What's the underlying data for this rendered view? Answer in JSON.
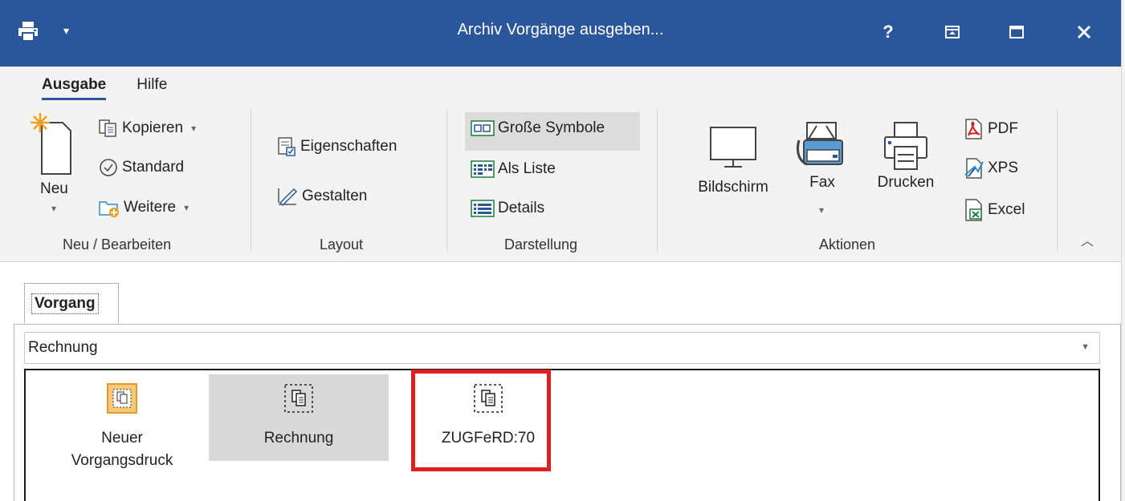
{
  "window": {
    "title": "Archiv Vorgänge ausgeben...",
    "help_label": "?",
    "qa_arrow": "▾"
  },
  "ribbon": {
    "tabs": [
      {
        "label": "Ausgabe",
        "active": true
      },
      {
        "label": "Hilfe",
        "active": false
      }
    ],
    "groups": {
      "neu": {
        "label": "Neu / Bearbeiten",
        "neu_button": "Neu",
        "kopieren": "Kopieren",
        "standard": "Standard",
        "weitere": "Weitere"
      },
      "layout": {
        "label": "Layout",
        "eigenschaften": "Eigenschaften",
        "gestalten": "Gestalten"
      },
      "darstellung": {
        "label": "Darstellung",
        "grosse_symbole": "Große Symbole",
        "als_liste": "Als Liste",
        "details": "Details"
      },
      "aktionen": {
        "label": "Aktionen",
        "bildschirm": "Bildschirm",
        "fax": "Fax",
        "drucken": "Drucken",
        "pdf": "PDF",
        "xps": "XPS",
        "excel": "Excel"
      }
    }
  },
  "content": {
    "tab_label": "Vorgang",
    "combo_value": "Rechnung",
    "items": [
      {
        "label_line1": "Neuer",
        "label_line2": "Vorgangsdruck"
      },
      {
        "label_line1": "Rechnung",
        "label_line2": ""
      },
      {
        "label_line1": "ZUGFeRD:70",
        "label_line2": ""
      }
    ]
  },
  "colors": {
    "titlebar": "#2b579a",
    "ribbon_bg": "#f3f3f3",
    "highlight": "#e02020",
    "selection": "#d9d9d9"
  }
}
